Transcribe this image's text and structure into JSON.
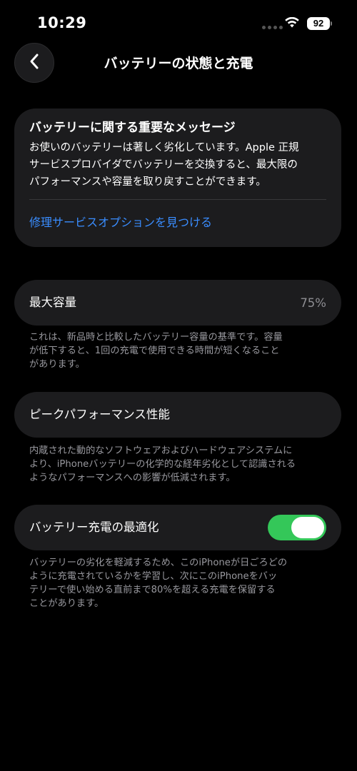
{
  "status_bar": {
    "time": "10:29",
    "battery_level": "92",
    "icons": [
      "signal-dots-icon",
      "wifi-icon",
      "battery-icon"
    ]
  },
  "header": {
    "title": "バッテリーの状態と充電",
    "back_icon": "chevron-left-icon"
  },
  "message_card": {
    "title": "バッテリーに関する重要なメッセージ",
    "lines": [
      "お使いのバッテリーは著しく劣化しています。Apple 正規",
      "サービスプロバイダでバッテリーを交換すると、最大限の",
      "パフォーマンスや容量を取り戻すことができます。"
    ],
    "link": "修理サービスオプションを見つける",
    "link_color": "#3a8dff"
  },
  "capacity": {
    "label": "最大容量",
    "value": "75%",
    "note_lines": [
      "これは、新品時と比較したバッテリー容量の基準です。容量",
      "が低下すると、1回の充電で使用できる時間が短くなること",
      "があります。"
    ]
  },
  "peak_performance": {
    "label": "ピークパフォーマンス性能",
    "note_lines": [
      "内蔵された動的なソフトウェアおよびハードウェアシステムに",
      "より、iPhoneバッテリーの化学的な経年劣化として認識される",
      "ようなパフォーマンスへの影響が低減されます。"
    ]
  },
  "charging_optimization": {
    "label": "バッテリー充電の最適化",
    "toggle_on": true,
    "toggle_color": "#34c759",
    "note_lines": [
      "バッテリーの劣化を軽減するため、このiPhoneが日ごろどの",
      "ように充電されているかを学習し、次にこのiPhoneをバッ",
      "テリーで使い始める直前まで80%を超える充電を保留する",
      "ことがあります。"
    ]
  }
}
